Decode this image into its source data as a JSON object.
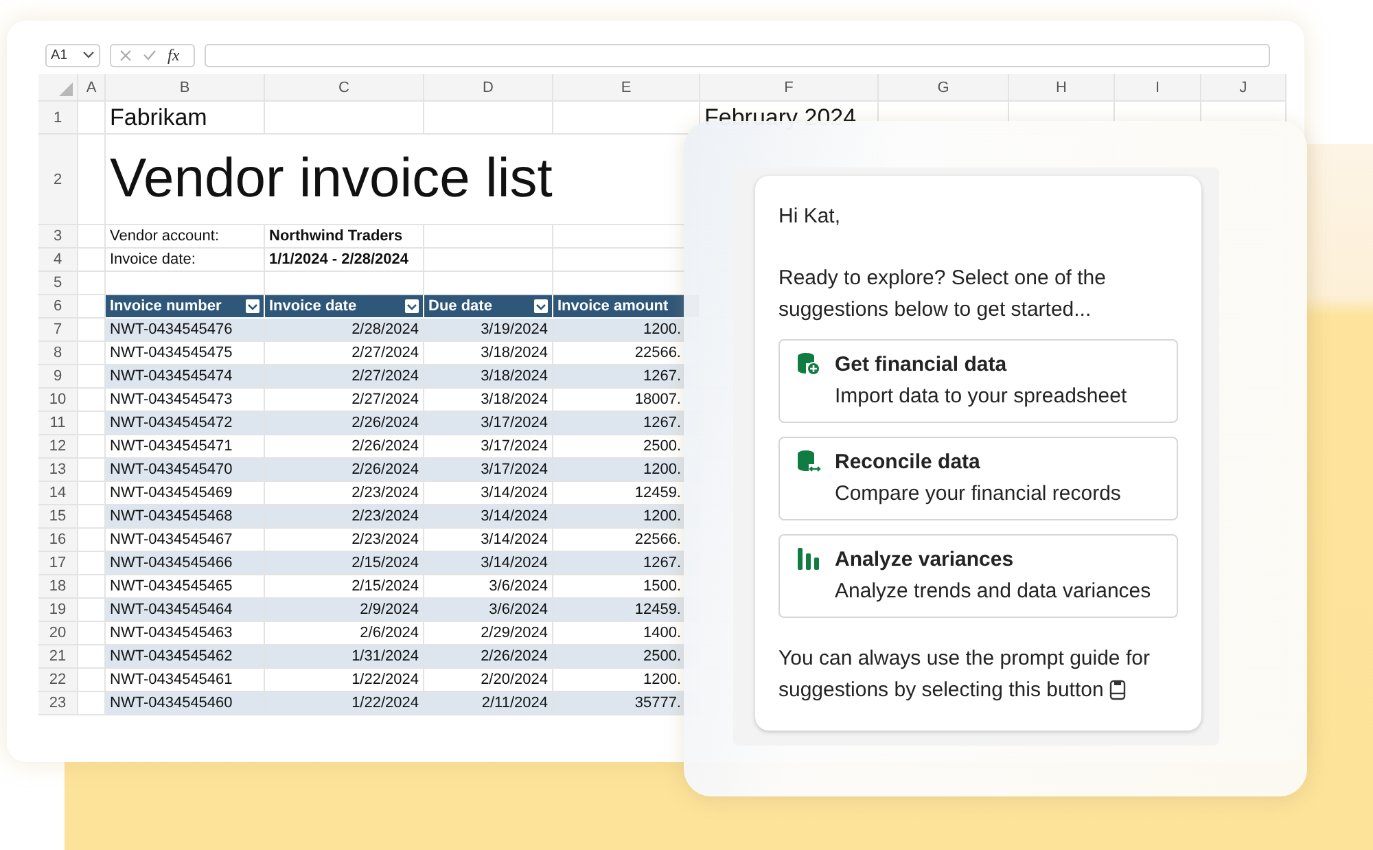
{
  "formula_bar": {
    "cell_ref": "A1",
    "function_label": "fx"
  },
  "column_letters": [
    "A",
    "B",
    "C",
    "D",
    "E",
    "F",
    "G",
    "H",
    "I",
    "J"
  ],
  "row_numbers": [
    "1",
    "2",
    "3",
    "4",
    "5",
    "6",
    "7",
    "8",
    "9",
    "10",
    "11",
    "12",
    "13",
    "14",
    "15",
    "16",
    "17",
    "18",
    "19",
    "20",
    "21",
    "22",
    "23"
  ],
  "sheet": {
    "company": "Fabrikam",
    "month": "February 2024",
    "title": "Vendor invoice list",
    "fields": [
      {
        "label": "Vendor account:",
        "value": "Northwind Traders"
      },
      {
        "label": "Invoice date:",
        "value": "1/1/2024 - 2/28/2024"
      }
    ]
  },
  "table": {
    "columns": [
      "Invoice number",
      "Invoice date",
      "Due date",
      "Invoice amount"
    ],
    "rows": [
      [
        "NWT-0434545476",
        "2/28/2024",
        "3/19/2024",
        "1200."
      ],
      [
        "NWT-0434545475",
        "2/27/2024",
        "3/18/2024",
        "22566."
      ],
      [
        "NWT-0434545474",
        "2/27/2024",
        "3/18/2024",
        "1267."
      ],
      [
        "NWT-0434545473",
        "2/27/2024",
        "3/18/2024",
        "18007."
      ],
      [
        "NWT-0434545472",
        "2/26/2024",
        "3/17/2024",
        "1267."
      ],
      [
        "NWT-0434545471",
        "2/26/2024",
        "3/17/2024",
        "2500."
      ],
      [
        "NWT-0434545470",
        "2/26/2024",
        "3/17/2024",
        "1200."
      ],
      [
        "NWT-0434545469",
        "2/23/2024",
        "3/14/2024",
        "12459."
      ],
      [
        "NWT-0434545468",
        "2/23/2024",
        "3/14/2024",
        "1200."
      ],
      [
        "NWT-0434545467",
        "2/23/2024",
        "3/14/2024",
        "22566."
      ],
      [
        "NWT-0434545466",
        "2/15/2024",
        "3/14/2024",
        "1267."
      ],
      [
        "NWT-0434545465",
        "2/15/2024",
        "3/6/2024",
        "1500."
      ],
      [
        "NWT-0434545464",
        "2/9/2024",
        "3/6/2024",
        "12459."
      ],
      [
        "NWT-0434545463",
        "2/6/2024",
        "2/29/2024",
        "1400."
      ],
      [
        "NWT-0434545462",
        "1/31/2024",
        "2/26/2024",
        "2500."
      ],
      [
        "NWT-0434545461",
        "1/22/2024",
        "2/20/2024",
        "1200."
      ],
      [
        "NWT-0434545460",
        "1/22/2024",
        "2/11/2024",
        "35777."
      ]
    ]
  },
  "assistant": {
    "greeting": "Hi Kat,",
    "intro": "Ready to explore? Select one of the suggestions below to get started...",
    "suggestions": [
      {
        "kind": "import",
        "title": "Get financial data",
        "subtitle": "Import data to your spreadsheet"
      },
      {
        "kind": "reconcile",
        "title": "Reconcile data",
        "subtitle": "Compare your financial records"
      },
      {
        "kind": "analyze",
        "title": "Analyze variances",
        "subtitle": "Analyze trends and data variances"
      }
    ],
    "footer": "You can always use the prompt guide for suggestions by selecting this button"
  }
}
